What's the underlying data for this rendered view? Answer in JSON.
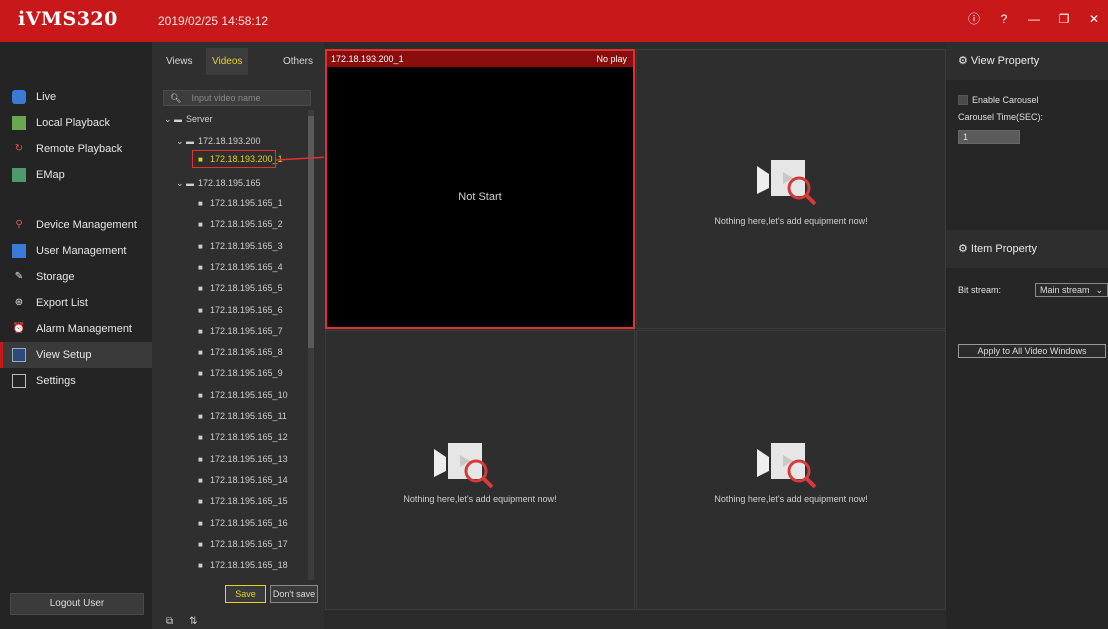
{
  "titlebar": {
    "app_name": "iVMS320",
    "datetime": "2019/02/25 14:58:12",
    "controls": [
      "ⓘ",
      "?",
      "—",
      "❐",
      "✕"
    ]
  },
  "nav": {
    "items": [
      {
        "label": "Live",
        "icon": "live-icon"
      },
      {
        "label": "Local Playback",
        "icon": "local-playback-icon"
      },
      {
        "label": "Remote Playback",
        "icon": "remote-playback-icon"
      },
      {
        "label": "EMap",
        "icon": "emap-icon"
      },
      {
        "label": "Device Management",
        "icon": "device-management-icon"
      },
      {
        "label": "User Management",
        "icon": "user-management-icon"
      },
      {
        "label": "Storage",
        "icon": "storage-icon"
      },
      {
        "label": "Export List",
        "icon": "export-list-icon"
      },
      {
        "label": "Alarm Management",
        "icon": "alarm-management-icon"
      },
      {
        "label": "View Setup",
        "icon": "view-setup-icon"
      },
      {
        "label": "Settings",
        "icon": "settings-icon"
      }
    ],
    "active": "View Setup",
    "logout": "Logout User"
  },
  "tree": {
    "tabs": [
      "Views",
      "Videos",
      "Others"
    ],
    "active_tab": "Videos",
    "search_placeholder": "Input video name",
    "server": "Server",
    "devices": [
      {
        "name": "172.18.193.200",
        "channels": [
          "172.18.193.200_1"
        ]
      },
      {
        "name": "172.18.195.165",
        "channels": [
          "172.18.195.165_1",
          "172.18.195.165_2",
          "172.18.195.165_3",
          "172.18.195.165_4",
          "172.18.195.165_5",
          "172.18.195.165_6",
          "172.18.195.165_7",
          "172.18.195.165_8",
          "172.18.195.165_9",
          "172.18.195.165_10",
          "172.18.195.165_11",
          "172.18.195.165_12",
          "172.18.195.165_13",
          "172.18.195.165_14",
          "172.18.195.165_15",
          "172.18.195.165_16",
          "172.18.195.165_17",
          "172.18.195.165_18"
        ]
      }
    ],
    "save": "Save",
    "dont_save": "Don't save"
  },
  "grid": {
    "cell1": {
      "title": "172.18.193.200_1",
      "status": "No play",
      "center": "Not Start"
    },
    "empty_message": "Nothing here,let's add equipment now!"
  },
  "right": {
    "view_property": "View Property",
    "enable_carousel": "Enable Carousel",
    "carousel_time_label": "Carousel Time(SEC):",
    "carousel_time_value": "1",
    "item_property": "Item Property",
    "bit_stream_label": "Bit stream:",
    "bit_stream_value": "Main stream",
    "apply_all": "Apply to All Video Windows"
  },
  "colors": {
    "accent": "#c8181a",
    "highlight": "#e6d21a",
    "selection": "#e03232"
  }
}
